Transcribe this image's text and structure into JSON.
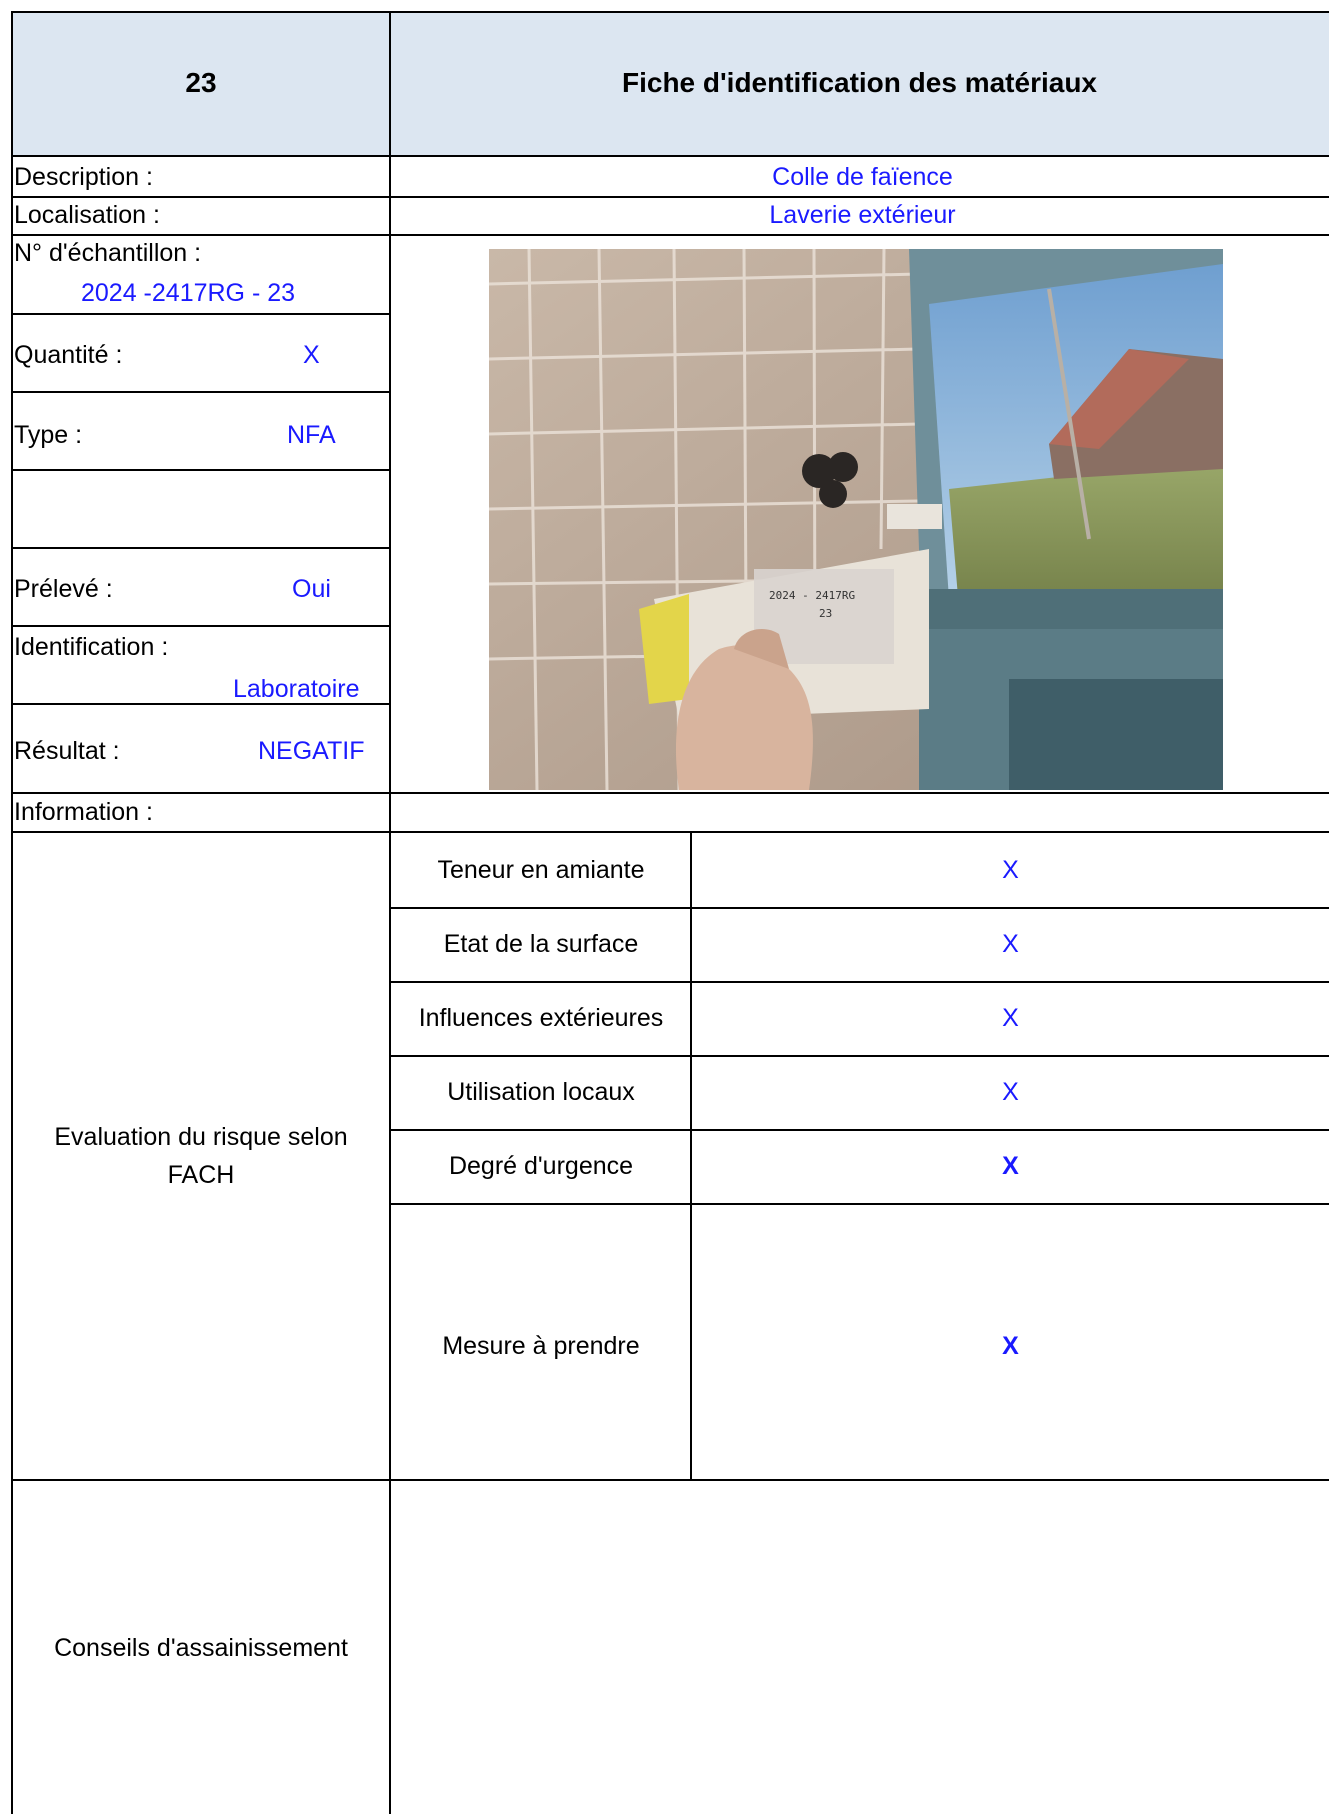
{
  "header": {
    "number": "23",
    "title": "Fiche d'identification des matériaux"
  },
  "fields": {
    "description_label": "Description :",
    "description_value": "Colle de faïence",
    "localisation_label": "Localisation :",
    "localisation_value": "Laverie extérieur",
    "sample_label": "N° d'échantillon :",
    "sample_value": "2024 -2417RG - 23",
    "quantity_label": "Quantité :",
    "quantity_value": "X",
    "type_label": "Type :",
    "type_value": "NFA",
    "preleve_label": "Prélevé :",
    "preleve_value": "Oui",
    "identification_label": "Identification :",
    "identification_value": "Laboratoire",
    "result_label": "Résultat :",
    "result_value": "NEGATIF",
    "information_label": "Information :"
  },
  "photo": {
    "label_text_line1": "2024 - 2417RG",
    "label_text_line2": "23"
  },
  "evaluation": {
    "title_line1": "Evaluation du risque selon",
    "title_line2": "FACH",
    "rows": [
      {
        "label": "Teneur en amiante",
        "value": "X"
      },
      {
        "label": "Etat de la surface",
        "value": "X"
      },
      {
        "label": "Influences extérieures",
        "value": "X"
      },
      {
        "label": "Utilisation locaux",
        "value": "X"
      },
      {
        "label": "Degré d'urgence",
        "value": "X"
      },
      {
        "label": "Mesure à prendre",
        "value": "X"
      }
    ]
  },
  "conseils": {
    "label": "Conseils d'assainissement"
  },
  "colors": {
    "header_bg": "#dce6f1",
    "value_text": "#1a1aff",
    "grid": "#000000"
  }
}
